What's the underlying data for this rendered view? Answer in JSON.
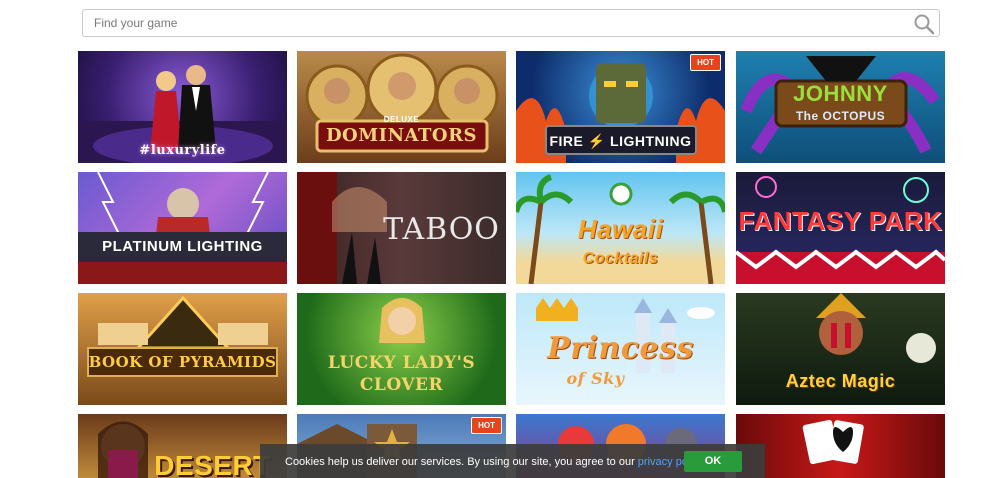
{
  "search": {
    "placeholder": "Find your game"
  },
  "games": [
    {
      "title": "#luxurylife",
      "badge": ""
    },
    {
      "title": "DOMINATORS",
      "subtitle": "DELUXE",
      "badge": ""
    },
    {
      "title": "FIRE ⚡ LIGHTNING",
      "badge": "HOT"
    },
    {
      "title": "JOHNNY",
      "subtitle": "The OCTOPUS",
      "badge": ""
    },
    {
      "title": "PLATINUM LIGHTING",
      "badge": ""
    },
    {
      "title": "TABOO",
      "badge": ""
    },
    {
      "title": "Hawaii",
      "subtitle": "Cocktails",
      "badge": ""
    },
    {
      "title": "FANTASY PARK",
      "badge": ""
    },
    {
      "title": "BOOK OF PYRAMIDS",
      "badge": ""
    },
    {
      "title": "LUCKY LADY'S",
      "subtitle": "CLOVER",
      "badge": ""
    },
    {
      "title": "Princess",
      "subtitle": "of Sky",
      "badge": ""
    },
    {
      "title": "Aztec Magic",
      "badge": ""
    },
    {
      "title": "DESERT",
      "badge": ""
    },
    {
      "title": "",
      "badge": "HOT"
    },
    {
      "title": "",
      "badge": ""
    },
    {
      "title": "",
      "badge": ""
    }
  ],
  "cookie": {
    "text": "Cookies help us deliver our services. By using our site, you agree to our",
    "link": "privacy policy",
    "ok": "OK"
  }
}
